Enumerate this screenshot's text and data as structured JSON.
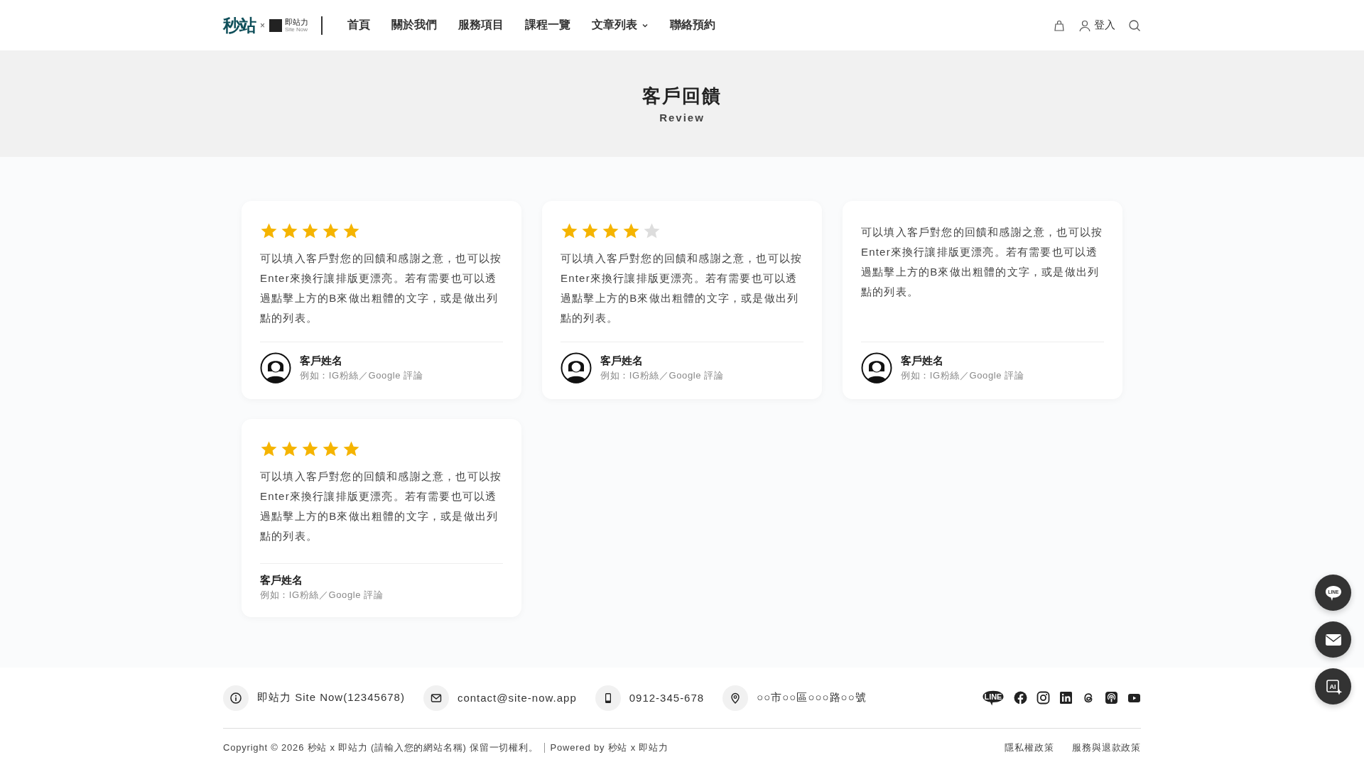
{
  "header": {
    "logo": {
      "main": "秒站",
      "times": "×",
      "partner": "即站力",
      "partner_sub": "Site Now"
    },
    "nav": [
      {
        "label": "首頁",
        "dropdown": false
      },
      {
        "label": "關於我們",
        "dropdown": false
      },
      {
        "label": "服務項目",
        "dropdown": false
      },
      {
        "label": "課程一覽",
        "dropdown": false
      },
      {
        "label": "文章列表",
        "dropdown": true
      },
      {
        "label": "聯絡預約",
        "dropdown": false
      }
    ],
    "login": "登入"
  },
  "hero": {
    "title": "客戶回饋",
    "subtitle": "Review"
  },
  "reviews": [
    {
      "stars": 5,
      "text": "可以填入客戶對您的回饋和感謝之意，也可以按Enter來換行讓排版更漂亮。若有需要也可以透過點擊上方的B來做出粗體的文字，或是做出列點的列表。",
      "name": "客戶姓名",
      "source": "例如：IG粉絲／Google 評論",
      "avatar": true
    },
    {
      "stars": 4,
      "text": "可以填入客戶對您的回饋和感謝之意，也可以按Enter來換行讓排版更漂亮。若有需要也可以透過點擊上方的B來做出粗體的文字，或是做出列點的列表。",
      "name": "客戶姓名",
      "source": "例如：IG粉絲／Google 評論",
      "avatar": true
    },
    {
      "text": "可以填入客戶對您的回饋和感謝之意，也可以按Enter來換行讓排版更漂亮。若有需要也可以透過點擊上方的B來做出粗體的文字，或是做出列點的列表。",
      "name": "客戶姓名",
      "source": "例如：IG粉絲／Google 評論",
      "avatar": true
    },
    {
      "stars": 5,
      "text": "可以填入客戶對您的回饋和感謝之意，也可以按Enter來換行讓排版更漂亮。若有需要也可以透過點擊上方的B來做出粗體的文字，或是做出列點的列表。",
      "name": "客戶姓名",
      "source": "例如：IG粉絲／Google 評論",
      "avatar": false
    }
  ],
  "floating_buttons": [
    {
      "kind": "line",
      "text": "LINE"
    },
    {
      "kind": "mail"
    },
    {
      "kind": "ai",
      "text": "AI"
    }
  ],
  "footer": {
    "contacts": [
      {
        "kind": "info",
        "text": "即站力 Site Now(12345678)"
      },
      {
        "kind": "mail",
        "text": "contact@site-now.app"
      },
      {
        "kind": "phone",
        "text": "0912-345-678"
      },
      {
        "kind": "pin",
        "text": "○○市○○區○○○路○○號"
      }
    ],
    "socials": [
      {
        "kind": "line",
        "text": "LINE"
      },
      {
        "kind": "facebook"
      },
      {
        "kind": "instagram"
      },
      {
        "kind": "linkedin"
      },
      {
        "kind": "threads"
      },
      {
        "kind": "podcast"
      },
      {
        "kind": "youtube"
      }
    ],
    "copyright": "Copyright © 2026 秒站 x 即站力 (請輸入您的網站名稱) 保留一切權利。",
    "powered": "Powered by 秒站 x 即站力",
    "links": [
      "隱私權政策",
      "服務與退款政策"
    ]
  }
}
